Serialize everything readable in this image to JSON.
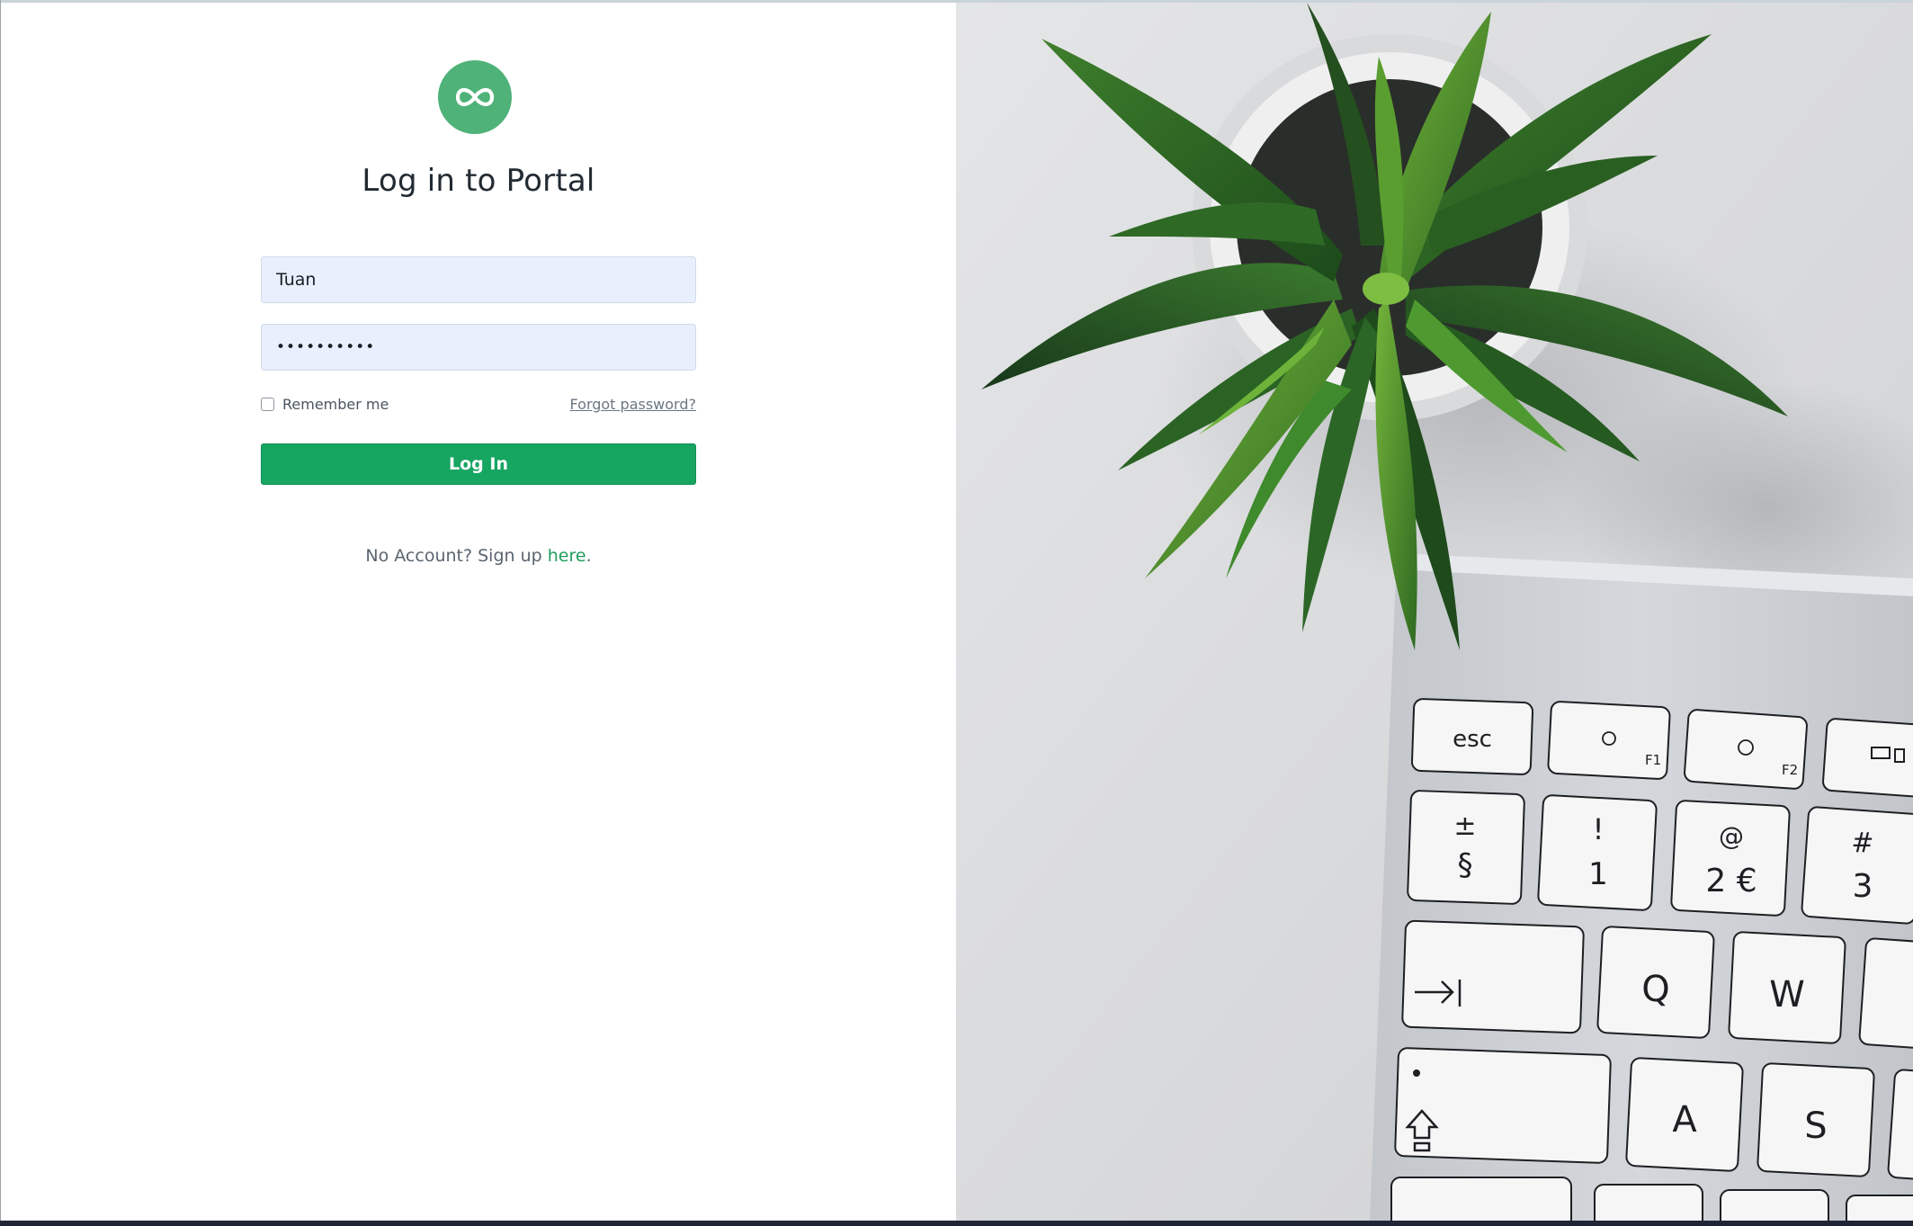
{
  "login": {
    "title": "Log in to Portal",
    "username_value": "Tuan",
    "password_masked": "••••••••••",
    "remember_label": "Remember me",
    "forgot_label": "Forgot password?",
    "login_button": "Log In",
    "signup_prefix": "No Account? Sign up ",
    "signup_link": "here",
    "signup_suffix": "."
  },
  "keyboard": {
    "esc": "esc",
    "f1": "F1",
    "f2": "F2",
    "plusminus": "±",
    "section": "§",
    "exclaim": "!",
    "one": "1",
    "at": "@",
    "two_euro": "2 €",
    "hash": "#",
    "three": "3",
    "q": "Q",
    "w": "W",
    "a": "A",
    "s": "S"
  },
  "colors": {
    "brand": "#4fb279",
    "button": "#17a562",
    "link": "#1e9e5c"
  },
  "icons": {
    "logo": "infinity-icon"
  }
}
